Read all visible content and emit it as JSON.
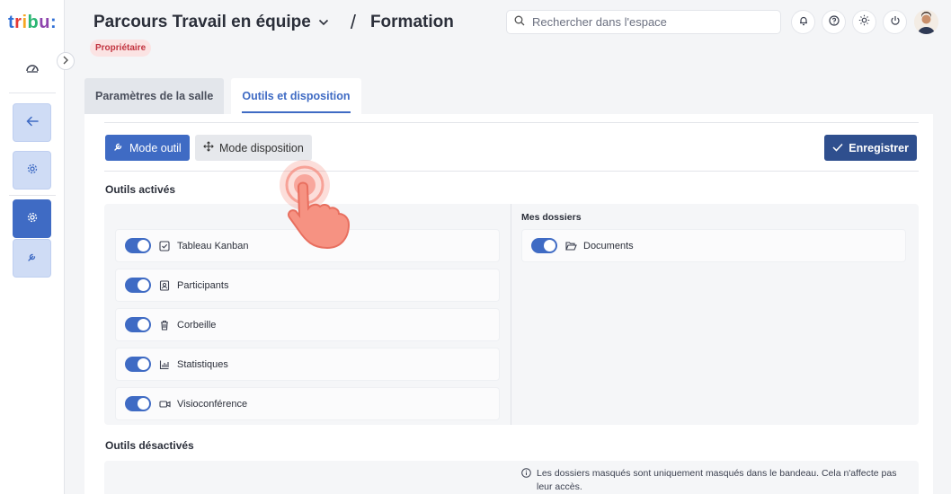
{
  "app": {
    "logo_letters": [
      "t",
      "r",
      "i",
      "b",
      "u",
      ":"
    ],
    "logo_colors": [
      "#2f6fd6",
      "#e53935",
      "#f5a623",
      "#2bb673",
      "#8e44ad",
      "#2f6fd6"
    ]
  },
  "header": {
    "title": "Parcours Travail en équipe",
    "breadcrumb_separator": "/",
    "breadcrumb_current": "Formation",
    "role_badge": "Propriétaire",
    "search_placeholder": "Rechercher dans l'espace",
    "icons": [
      "bell-icon",
      "help-icon",
      "sun-icon",
      "power-icon"
    ]
  },
  "tabs": [
    {
      "label": "Paramètres de la salle",
      "active": false
    },
    {
      "label": "Outils et disposition",
      "active": true
    }
  ],
  "toolbar": {
    "mode_tool_label": "Mode outil",
    "mode_layout_label": "Mode disposition",
    "save_label": "Enregistrer"
  },
  "sections": {
    "active_title": "Outils activés",
    "disabled_title": "Outils désactivés",
    "folders_heading": "Mes dossiers"
  },
  "active_tools": [
    {
      "label": "Tableau Kanban",
      "icon": "kanban-check-icon",
      "enabled": true
    },
    {
      "label": "Participants",
      "icon": "participants-icon",
      "enabled": true
    },
    {
      "label": "Corbeille",
      "icon": "trash-icon",
      "enabled": true
    },
    {
      "label": "Statistiques",
      "icon": "chart-icon",
      "enabled": true
    },
    {
      "label": "Visioconférence",
      "icon": "video-icon",
      "enabled": true
    }
  ],
  "folders": [
    {
      "label": "Documents",
      "icon": "folder-open-icon",
      "enabled": true
    }
  ],
  "info_note": "Les dossiers masqués sont uniquement masqués dans le bandeau. Cela n'affecte pas leur accès.",
  "colors": {
    "accent": "#3f6bc4",
    "save": "#2f4f8e",
    "badge_bg": "#fbe3e3",
    "badge_text": "#c2333f",
    "hand": "#f47a6b"
  }
}
